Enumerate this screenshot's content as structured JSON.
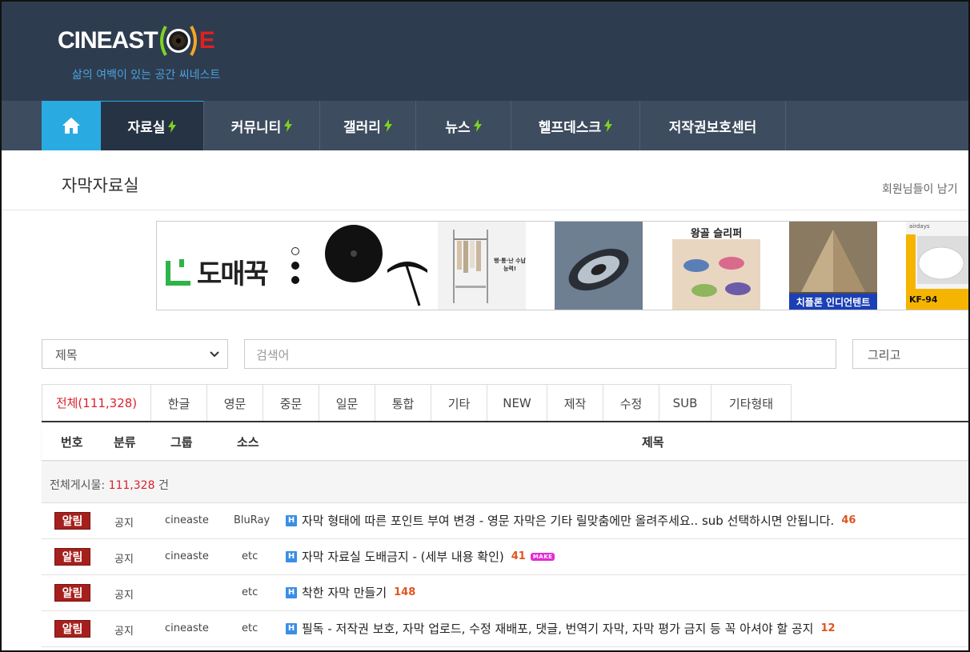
{
  "header": {
    "logo_text": "CINEAST",
    "logo_suffix": "E",
    "tagline": "삶의 여백이 있는 공간 씨네스트"
  },
  "nav": {
    "items": [
      {
        "label": "자료실",
        "bolt": true,
        "active": true
      },
      {
        "label": "커뮤니티",
        "bolt": true
      },
      {
        "label": "갤러리",
        "bolt": true
      },
      {
        "label": "뉴스",
        "bolt": true
      },
      {
        "label": "헬프데스크",
        "bolt": true
      },
      {
        "label": "저작권보호센터",
        "bolt": false
      }
    ]
  },
  "page": {
    "title": "자막자료실",
    "right_text": "회원님들이 남기"
  },
  "banner": {
    "logo_text": "도매꾹",
    "products": [
      {
        "name": "umbrella"
      },
      {
        "name": "clothes-rack",
        "caption": "행·통·난 수납 능력!"
      },
      {
        "name": "phone-holder"
      },
      {
        "name": "slippers",
        "caption": "왕골 슬리퍼"
      },
      {
        "name": "tent",
        "caption": "치플론 인디언텐트"
      },
      {
        "name": "mask",
        "caption": "KF-94",
        "brand": "airdays"
      }
    ]
  },
  "search": {
    "field_select": "제목",
    "placeholder": "검색어",
    "operator": "그리고"
  },
  "tabs": [
    "전체(111,328)",
    "한글",
    "영문",
    "중문",
    "일문",
    "통합",
    "기타",
    "NEW",
    "제작",
    "수정",
    "SUB",
    "기타형태"
  ],
  "table": {
    "headers": {
      "no": "번호",
      "category": "분류",
      "group": "그룹",
      "source": "소스",
      "subject": "제목"
    },
    "summary_label": "전체게시물:",
    "summary_count": "111,328",
    "summary_unit": "건",
    "rows": [
      {
        "badge": "알림",
        "category": "공지",
        "group": "cineaste",
        "source": "BluRay",
        "subject": "자막 형태에 따른 포인트 부여 변경 - 영문 자막은 기타 릴맞춤에만 올려주세요.. sub 선택하시면 안됩니다.",
        "comments": "46"
      },
      {
        "badge": "알림",
        "category": "공지",
        "group": "cineaste",
        "source": "etc",
        "subject": "자막 자료실 도배금지 - (세부 내용 확인)",
        "comments": "41",
        "tag": "MAKE"
      },
      {
        "badge": "알림",
        "category": "공지",
        "group": "",
        "source": "etc",
        "subject": "착한 자막 만들기",
        "comments": "148"
      },
      {
        "badge": "알림",
        "category": "공지",
        "group": "cineaste",
        "source": "etc",
        "subject": "필독 - 저작권 보호, 자막 업로드, 수정 재배포, 댓글, 번역기 자막, 자막 평가 금지 등 꼭 아셔야 할 공지",
        "comments": "12"
      }
    ]
  },
  "colors": {
    "header_bg": "#2e3c4f",
    "nav_bg": "#3d4c5f",
    "home_accent": "#29abe2",
    "bolt": "#7ed321",
    "active_tab": "#d9232d",
    "badge_bg": "#a5201d",
    "comment_count": "#e0541e"
  }
}
